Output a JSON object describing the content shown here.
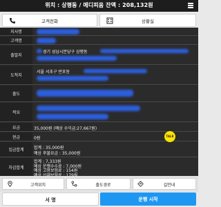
{
  "header": {
    "title": "위치 : 상평동 / 메디피움 잔액 : 208,132원"
  },
  "top_buttons": {
    "customer_call": "고객전화",
    "merchant_call": "상황실"
  },
  "info": {
    "labels": {
      "store": "지사명",
      "customer": "고객명",
      "departure": "출발지",
      "arrival": "도착지",
      "depart_time": "출도",
      "memo": "적요",
      "fee": "요금",
      "cash": "현금",
      "deposit_total": "입금합계",
      "deduction_total": "차감합계"
    },
    "departure_value": "경기 성남시분당구 상평동",
    "arrival_value": "서울 서초구 반포동",
    "fee_value": "35,000원 (예상 수익금:27,667원)",
    "cash_value": "0원",
    "deposit_lines": [
      "합계 : 35,000원",
      "예상 후불요금 : 35,000원"
    ],
    "deduction_lines": [
      "합계 : 7,333원",
      "예상 운행수수료 : 7,000원",
      "예상 고용보험료 : 154원",
      "예상 산재보험료 : 179원"
    ],
    "kakao_label": "TALK"
  },
  "mid_buttons": {
    "customer_location": "고객위치",
    "route": "출도경로",
    "guide": "길안내"
  },
  "bottom_buttons": {
    "sign": "서 명",
    "start": "운행 시작"
  },
  "colors": {
    "accent": "#1e97f3",
    "redaction": "#2d62e8",
    "kakao": "#f7e600"
  },
  "icons": [
    "phone-icon",
    "building-icon",
    "menu-icon",
    "location-pin-icon",
    "route-icon",
    "navigation-icon",
    "kakao-talk-icon"
  ]
}
